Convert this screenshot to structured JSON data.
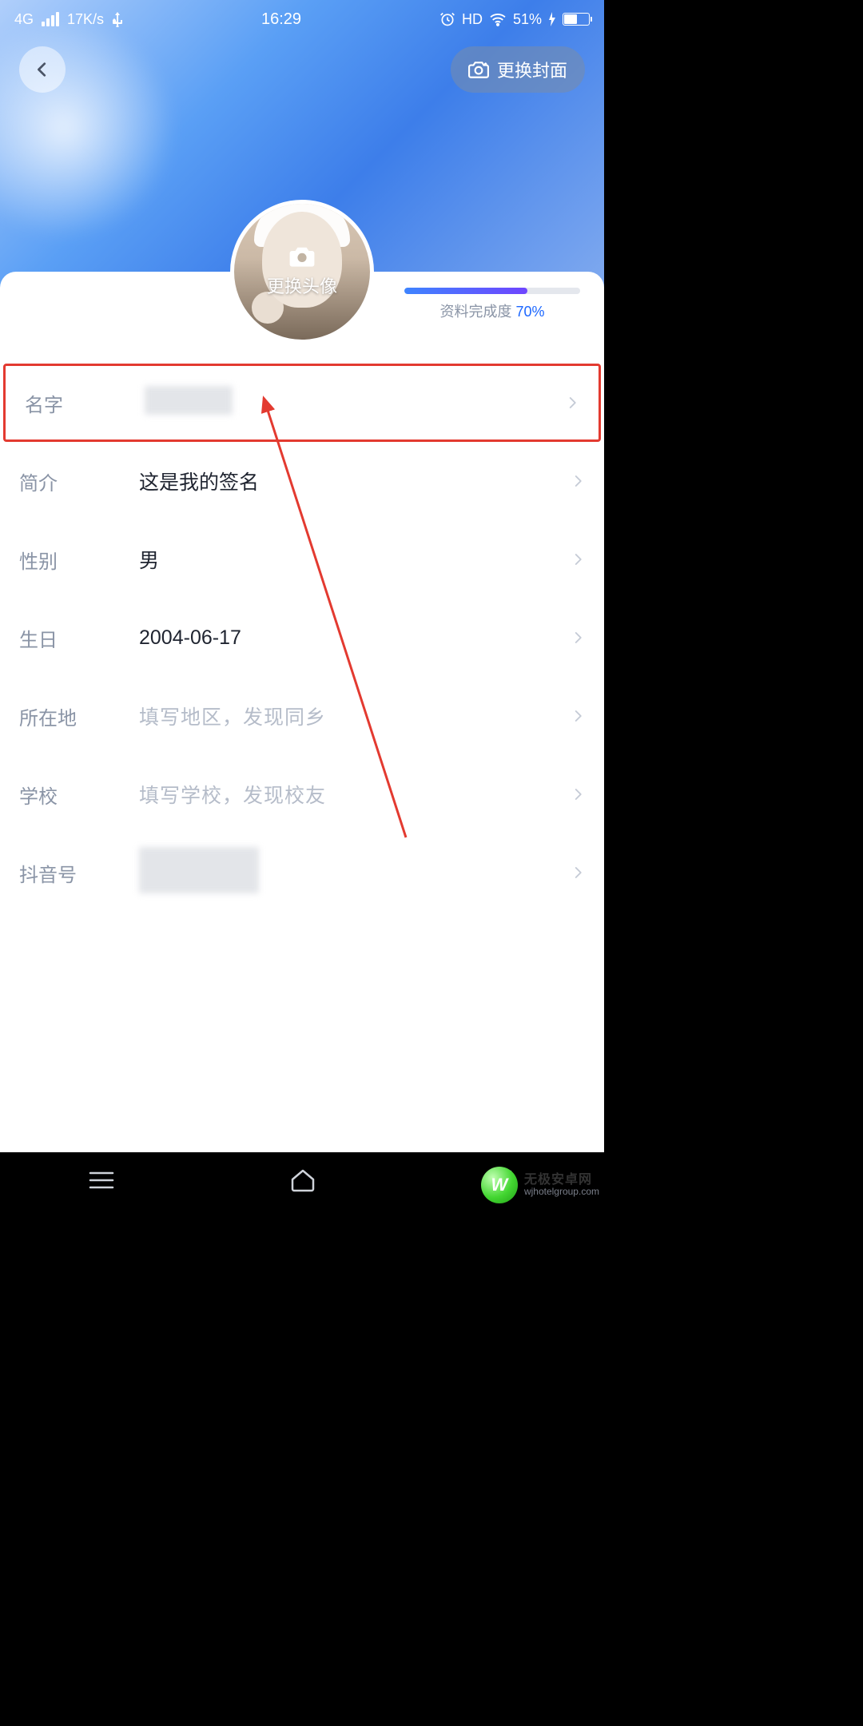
{
  "status": {
    "network": "4G",
    "speed": "17K/s",
    "time": "16:29",
    "hd": "HD",
    "battery_pct": "51%"
  },
  "cover": {
    "change_label": "更换封面"
  },
  "avatar": {
    "change_label": "更换头像"
  },
  "progress": {
    "label_prefix": "资料完成度 ",
    "value": "70%"
  },
  "rows": {
    "name": {
      "label": "名字",
      "value": ""
    },
    "bio": {
      "label": "简介",
      "value": "这是我的签名"
    },
    "gender": {
      "label": "性别",
      "value": "男"
    },
    "birth": {
      "label": "生日",
      "value": "2004-06-17"
    },
    "region": {
      "label": "所在地",
      "placeholder": "填写地区，发现同乡"
    },
    "school": {
      "label": "学校",
      "placeholder": "填写学校，发现校友"
    },
    "douyin": {
      "label": "抖音号",
      "value": ""
    }
  },
  "watermark": {
    "title": "无极安卓网",
    "sub": "wjhotelgroup.com"
  }
}
